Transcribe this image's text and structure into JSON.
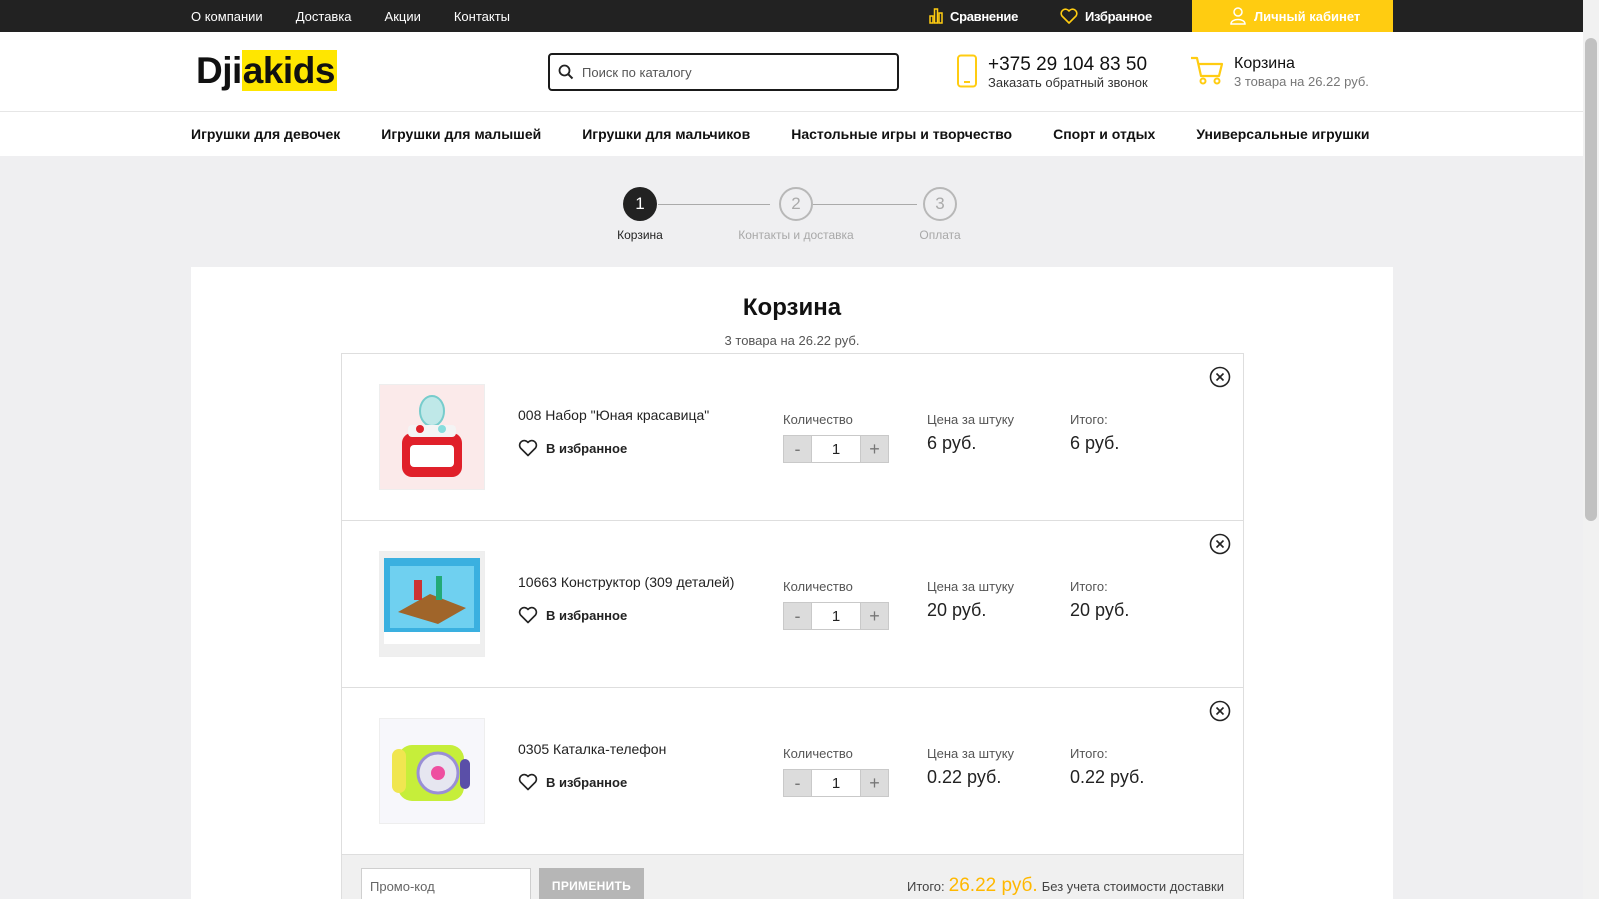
{
  "topbar": {
    "nav": [
      "О компании",
      "Доставка",
      "Акции",
      "Контакты"
    ],
    "compare": "Сравнение",
    "favorites": "Избранное",
    "cabinet": "Личный кабинет"
  },
  "header": {
    "logo_part1": "Dji",
    "logo_part2": "akids",
    "search_placeholder": "Поиск по каталогу",
    "phone": "+375 29 104 83 50",
    "callback": "Заказать обратный звонок",
    "cart_title": "Корзина",
    "cart_sub": "3 товара на 26.22 руб."
  },
  "categories": [
    "Игрушки для девочек",
    "Игрушки для малышей",
    "Игрушки для мальчиков",
    "Настольные игры и творчество",
    "Спорт и отдых",
    "Универсальные игрушки"
  ],
  "steps": [
    {
      "num": "1",
      "label": "Корзина"
    },
    {
      "num": "2",
      "label": "Контакты и доставка"
    },
    {
      "num": "3",
      "label": "Оплата"
    }
  ],
  "cart": {
    "title": "Корзина",
    "count": "3 товара на 26.22 руб.",
    "qty_label": "Количество",
    "price_label": "Цена за штуку",
    "total_label": "Итого:",
    "fav_label": "В избранное",
    "minus": "-",
    "plus": "+",
    "items": [
      {
        "name": "008 Набор \"Юная красавица\"",
        "qty": "1",
        "price": "6 руб.",
        "total": "6 руб."
      },
      {
        "name": "10663 Конструктор (309 деталей)",
        "qty": "1",
        "price": "20 руб.",
        "total": "20 руб."
      },
      {
        "name": "0305 Каталка-телефон",
        "qty": "1",
        "price": "0.22 руб.",
        "total": "0.22 руб."
      }
    ],
    "promo_placeholder": "Промо-код",
    "apply": "ПРИМЕНИТЬ",
    "footer_total_label": "Итого:",
    "footer_total_value": "26.22 руб.",
    "footer_note": "Без учета стоимости доставки"
  },
  "colors": {
    "accent": "#ffcc11",
    "dark": "#222222",
    "sum": "#ffb800"
  }
}
